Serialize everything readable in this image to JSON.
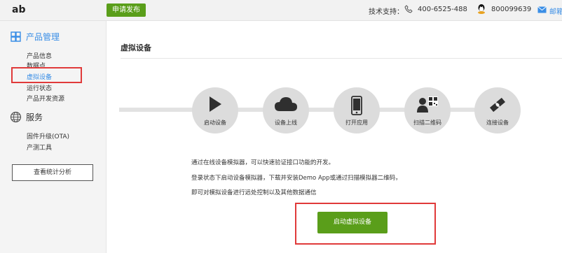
{
  "header": {
    "logo": "ab",
    "publish_label": "申请发布",
    "support_label": "技术支持：",
    "phone": "400-6525-488",
    "qq": "800099639",
    "mail_text": "邮箱"
  },
  "sidebar": {
    "sections": [
      {
        "title": "产品管理",
        "icon": "cube-icon",
        "color": "#3a8ee6",
        "items": [
          "产品信息",
          "数据点",
          "虚拟设备",
          "运行状态",
          "产品开发资源"
        ],
        "active_index": 2
      },
      {
        "title": "服务",
        "icon": "globe-icon",
        "color": "#333333",
        "items": [
          "固件升级(OTA)",
          "产测工具"
        ]
      }
    ],
    "stats_button": "查看统计分析"
  },
  "main": {
    "title": "虚拟设备",
    "steps": [
      {
        "label": "启动设备",
        "icon": "play-icon"
      },
      {
        "label": "设备上线",
        "icon": "cloud-icon"
      },
      {
        "label": "打开应用",
        "icon": "phone-icon"
      },
      {
        "label": "扫描二维码",
        "icon": "qr-scan-icon"
      },
      {
        "label": "连接设备",
        "icon": "connect-icon"
      }
    ],
    "description": [
      "通过在线设备模拟器，可以快速验证接口功能的开发。",
      "登录状态下启动设备模拟器，下载并安装Demo App或通过扫描模拟器二维码，",
      "即可对模拟设备进行远处控制以及其他数据通信"
    ],
    "start_button": "启动虚拟设备"
  },
  "colors": {
    "accent_green": "#5a9e1a",
    "link_blue": "#3a8ee6",
    "highlight_red": "#e03a3a"
  }
}
